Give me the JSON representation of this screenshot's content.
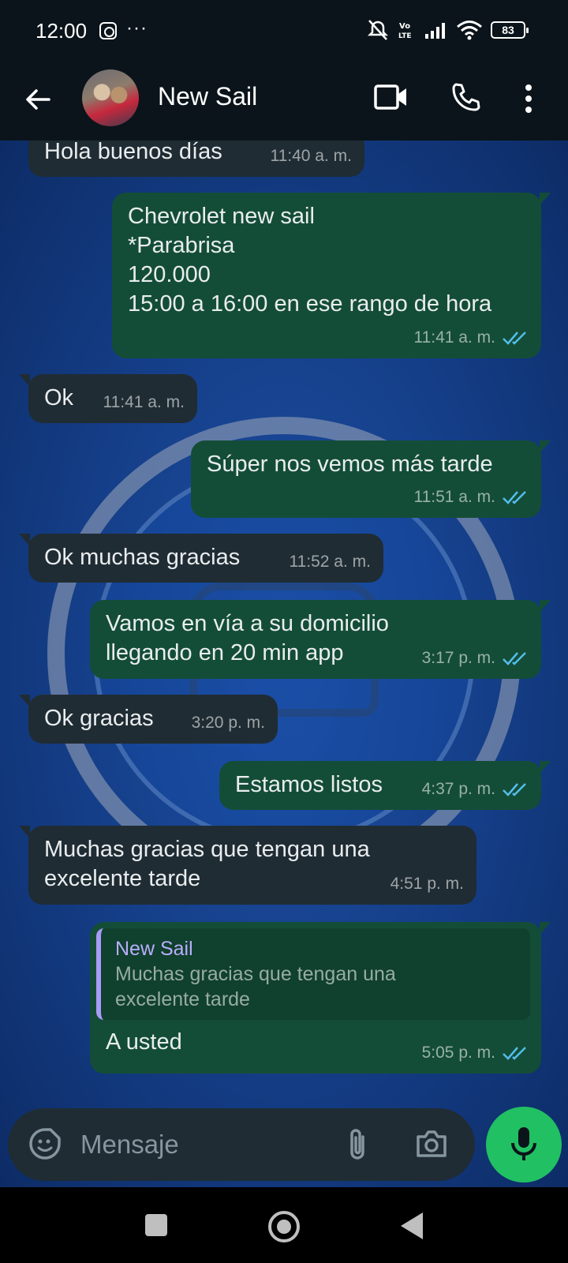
{
  "status_bar": {
    "time": "12:00",
    "battery": "83",
    "network": "Vo LTE"
  },
  "header": {
    "contact_name": "New Sail"
  },
  "messages": [
    {
      "direction": "in",
      "text": "Hola buenos días",
      "time": "11:40 a. m."
    },
    {
      "direction": "out",
      "text": "Chevrolet new sail\n*Parabrisa\n120.000\n15:00 a 16:00 en ese rango de hora",
      "time": "11:41 a. m.",
      "read": true
    },
    {
      "direction": "in",
      "text": "Ok",
      "time": "11:41 a. m."
    },
    {
      "direction": "out",
      "text": "Súper nos vemos más tarde",
      "time": "11:51 a. m.",
      "read": true
    },
    {
      "direction": "in",
      "text": "Ok muchas gracias",
      "time": "11:52 a. m."
    },
    {
      "direction": "out",
      "text": "Vamos en vía a su domicilio\nllegando en 20 min app",
      "time": "3:17 p. m.",
      "read": true
    },
    {
      "direction": "in",
      "text": "Ok gracias",
      "time": "3:20 p. m."
    },
    {
      "direction": "out",
      "text": "Estamos listos",
      "time": "4:37 p. m.",
      "read": true
    },
    {
      "direction": "in",
      "text": "Muchas gracias que tengan una\nexcelente tarde",
      "time": "4:51 p. m."
    },
    {
      "direction": "out",
      "text": "A usted",
      "time": "5:05 p. m.",
      "read": true,
      "quote": {
        "name": "New Sail",
        "text": "Muchas gracias que tengan una\nexcelente tarde"
      }
    }
  ],
  "composer": {
    "placeholder": "Mensaje"
  },
  "colors": {
    "incoming_bubble": "#202c33",
    "outgoing_bubble": "#144d37",
    "read_ticks": "#53bdeb",
    "mic_button": "#21c063"
  },
  "icons": [
    "back-arrow-icon",
    "video-call-icon",
    "phone-icon",
    "more-vert-icon",
    "sticker-icon",
    "attach-icon",
    "camera-icon",
    "mic-icon"
  ]
}
